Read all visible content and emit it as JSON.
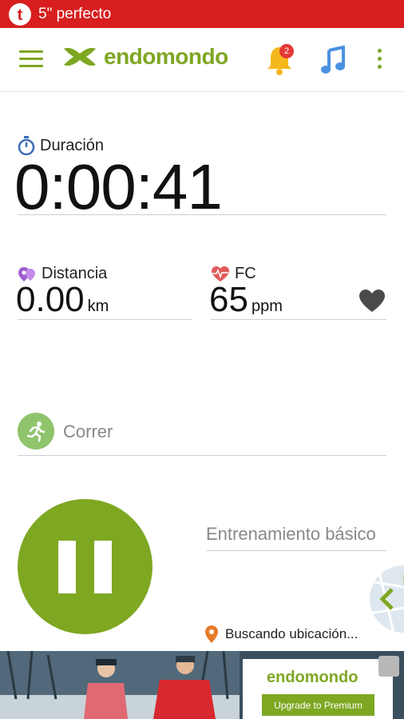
{
  "notification": {
    "text": "5\" perfecto",
    "color": "#d81e1e"
  },
  "app_bar": {
    "title": "endomondo",
    "notification_count": "2"
  },
  "duration": {
    "label": "Duración",
    "value": "0:00:41"
  },
  "distance": {
    "label": "Distancia",
    "value": "0.00",
    "unit": "km"
  },
  "heart_rate": {
    "label": "FC",
    "value": "65",
    "unit": "ppm"
  },
  "sport": {
    "label": "Correr"
  },
  "workout": {
    "label": "Entrenamiento básico"
  },
  "location": {
    "status": "Buscando ubicación..."
  },
  "ad": {
    "brand": "endomondo",
    "cta": "Upgrade to Premium"
  },
  "colors": {
    "accent": "#7ea722",
    "sport_bg": "#8fc46c",
    "bell": "#f5b81c",
    "music": "#4a90e2"
  }
}
